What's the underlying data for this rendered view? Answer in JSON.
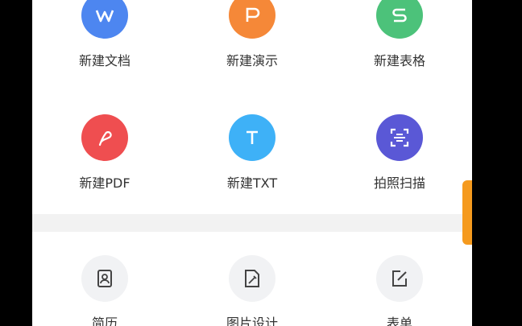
{
  "create": [
    {
      "label": "新建文档",
      "letter": "W",
      "color": "#4d86f0"
    },
    {
      "label": "新建演示",
      "letter": "P",
      "color": "#f58838"
    },
    {
      "label": "新建表格",
      "letter": "S",
      "color": "#4cc27a"
    },
    {
      "label": "新建PDF",
      "letter": "",
      "color": "#ef4e50"
    },
    {
      "label": "新建TXT",
      "letter": "T",
      "color": "#3eb1f7"
    },
    {
      "label": "拍照扫描",
      "letter": "",
      "color": "#5a58d6"
    }
  ],
  "templates": [
    {
      "label": "简历"
    },
    {
      "label": "图片设计"
    },
    {
      "label": "表单"
    }
  ],
  "colors": {
    "accent_scroll": "#f59a1e",
    "separator": "#f2f2f2",
    "template_circle_bg": "#f1f2f4"
  }
}
